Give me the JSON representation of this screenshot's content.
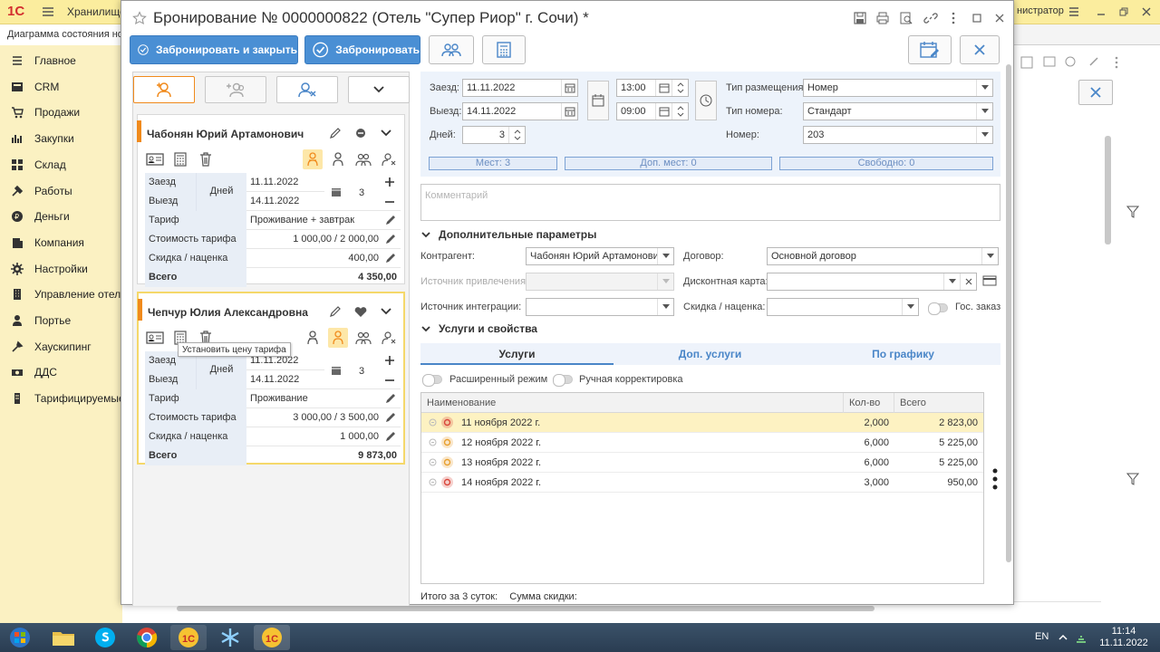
{
  "background": {
    "app_logo": "1С",
    "app_title": "Хранилище",
    "user_name": "нистратор",
    "tab_label": "Диаграмма состояния ном",
    "sidebar": [
      {
        "label": "Главное",
        "icon": "menu-icon"
      },
      {
        "label": "CRM",
        "icon": "crm-icon"
      },
      {
        "label": "Продажи",
        "icon": "sales-icon"
      },
      {
        "label": "Закупки",
        "icon": "purchases-icon"
      },
      {
        "label": "Склад",
        "icon": "warehouse-icon"
      },
      {
        "label": "Работы",
        "icon": "work-icon"
      },
      {
        "label": "Деньги",
        "icon": "money-icon"
      },
      {
        "label": "Компания",
        "icon": "company-icon"
      },
      {
        "label": "Настройки",
        "icon": "settings-icon"
      },
      {
        "label": "Управление отелем",
        "icon": "hotel-icon"
      },
      {
        "label": "Портье",
        "icon": "porter-icon"
      },
      {
        "label": "Хаускипинг",
        "icon": "housekeeping-icon"
      },
      {
        "label": "ДДС",
        "icon": "cashflow-icon"
      },
      {
        "label": "Тарифицируемые з",
        "icon": "billing-icon"
      }
    ]
  },
  "dialog": {
    "title": "Бронирование  № 0000000822 (Отель \"Супер Риор\" г. Сочи) *",
    "toolbar": {
      "book_and_close": "Забронировать и закрыть",
      "book": "Забронировать"
    },
    "guests": [
      {
        "name": "Чабонян Юрий Артамонович",
        "checkin_label": "Заезд",
        "checkout_label": "Выезд",
        "days_label": "Дней",
        "checkin": "11.11.2022",
        "checkout": "14.11.2022",
        "days": "3",
        "tariff_label": "Тариф",
        "tariff": "Проживание + завтрак",
        "cost_label": "Стоимость тарифа",
        "cost": "1 000,00 / 2 000,00",
        "discount_label": "Скидка / наценка",
        "discount": "400,00",
        "total_label": "Всего",
        "total": "4 350,00"
      },
      {
        "name": "Чепчур Юлия Александровна",
        "checkin_label": "Заезд",
        "checkout_label": "Выезд",
        "days_label": "Дней",
        "checkin": "11.11.2022",
        "checkout": "14.11.2022",
        "days": "3",
        "tariff_label": "Тариф",
        "tariff": "Проживание",
        "cost_label": "Стоимость тарифа",
        "cost": "3 000,00 / 3 500,00",
        "discount_label": "Скидка / наценка",
        "discount": "1 000,00",
        "total_label": "Всего",
        "total": "9 873,00"
      }
    ],
    "tooltip": "Установить цену тарифа",
    "form": {
      "checkin_label": "Заезд:",
      "checkin_date": "11.11.2022",
      "checkin_time": "13:00",
      "checkout_label": "Выезд:",
      "checkout_date": "14.11.2022",
      "checkout_time": "09:00",
      "days_label": "Дней:",
      "days": "3",
      "placement_label": "Тип размещения:",
      "placement": "Номер",
      "room_type_label": "Тип номера:",
      "room_type": "Стандарт",
      "room_label": "Номер:",
      "room": "203",
      "places": "Мест: 3",
      "extra_places": "Доп. мест: 0",
      "free": "Свободно: 0",
      "comment_placeholder": "Комментарий",
      "extra_params_header": "Дополнительные параметры",
      "counterparty_label": "Контрагент:",
      "counterparty": "Чабонян Юрий Артамонович",
      "contract_label": "Договор:",
      "contract": "Основной договор",
      "source_label": "Источник привлечения:",
      "discount_card_label": "Дисконтная карта:",
      "integration_label": "Источник интеграции:",
      "markup_label": "Скидка / наценка:",
      "gov_order_label": "Гос. заказ",
      "services_header": "Услуги и свойства",
      "tabs": [
        "Услуги",
        "Доп. услуги",
        "По графику"
      ],
      "extended_mode": "Расширенный режим",
      "manual_adjust": "Ручная корректировка",
      "table_headers": [
        "Наименование",
        "Кол-во",
        "Всего"
      ],
      "rows": [
        {
          "name": "11 ноября 2022 г.",
          "qty": "2,000",
          "total": "2 823,00",
          "status": "red"
        },
        {
          "name": "12 ноября 2022 г.",
          "qty": "6,000",
          "total": "5 225,00",
          "status": "orange"
        },
        {
          "name": "13 ноября 2022 г.",
          "qty": "6,000",
          "total": "5 225,00",
          "status": "orange"
        },
        {
          "name": "14 ноября 2022 г.",
          "qty": "3,000",
          "total": "950,00",
          "status": "red"
        }
      ],
      "footer_total": "Итого за 3 суток:",
      "footer_discount": "Сумма скидки:"
    }
  },
  "taskbar": {
    "lang": "EN",
    "time": "11:14",
    "date": "11.11.2022"
  },
  "colors": {
    "accent": "#4a8fd4",
    "guest_accent": "#f08a1c",
    "status_red": "#d9463b",
    "status_orange": "#e8a030"
  }
}
